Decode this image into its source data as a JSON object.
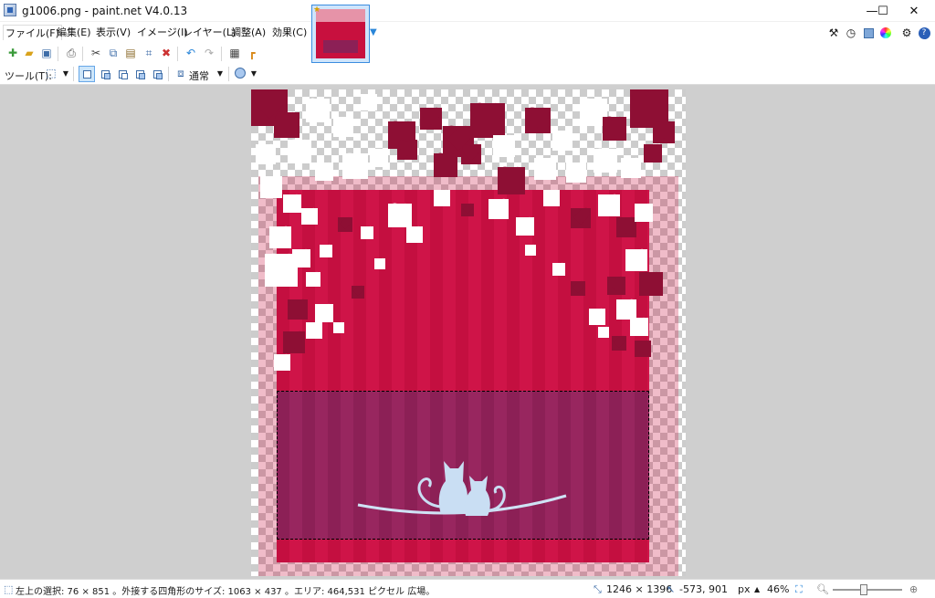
{
  "window": {
    "title": "g1006.png - paint.net V4.0.13",
    "minimize": "—",
    "maximize": "☐",
    "close": "✕"
  },
  "menu": {
    "items": [
      "ファイル(F)",
      "編集(E)",
      "表示(V)",
      "イメージ(I)",
      "レイヤー(L)",
      "調整(A)",
      "効果(C)"
    ]
  },
  "toolbar": {
    "tools_label": "ツール(T):",
    "blend_mode": "通常"
  },
  "status": {
    "selection_info": "左上の選択: 76 × 851 。外接する四角形のサイズ: 1063 × 437 。エリア: 464,531 ピクセル 広場。",
    "image_size": "1246 × 1396",
    "cursor_position": "-573, 901",
    "units": "px",
    "zoom": "46%"
  },
  "colors": {
    "accent": "#2a86d9",
    "card_red": "#c40f40",
    "band_purple": "#8c2056",
    "heart_dark": "#8e0f34",
    "heart_white": "#ffffff"
  }
}
